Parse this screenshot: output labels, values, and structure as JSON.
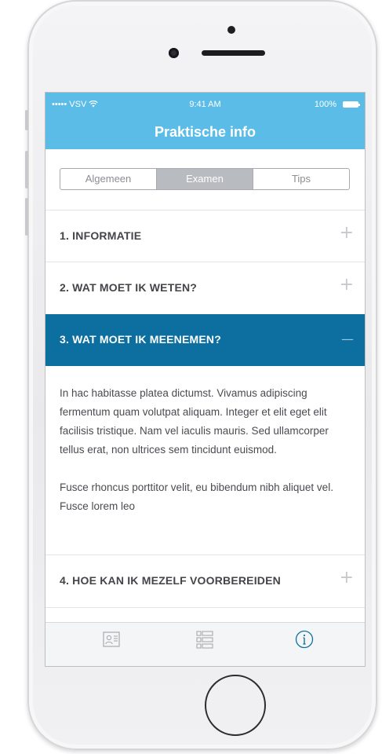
{
  "status_bar": {
    "carrier": "••••• VSV",
    "wifi_icon": "wifi-icon",
    "time": "9:41 AM",
    "battery": "100%"
  },
  "nav": {
    "title": "Praktische info"
  },
  "segments": [
    {
      "label": "Algemeen",
      "active": false
    },
    {
      "label": "Examen",
      "active": true
    },
    {
      "label": "Tips",
      "active": false
    }
  ],
  "accordion": [
    {
      "label": "1. INFORMATIE",
      "icon": "+",
      "expanded": false
    },
    {
      "label": "2. WAT MOET IK WETEN?",
      "icon": "+",
      "expanded": false
    },
    {
      "label": "3. WAT MOET IK MEENEMEN?",
      "icon": "—",
      "expanded": true
    },
    {
      "label": "4. HOE KAN IK MEZELF VOORBEREIDEN",
      "icon": "+",
      "expanded": false
    }
  ],
  "expanded_content": {
    "paragraph1": "In hac habitasse platea dictumst. Vivamus adipiscing fermentum quam volutpat aliquam. Integer et elit eget elit facilisis tristique. Nam vel iaculis mauris. Sed ullamcorper tellus erat, non ultrices sem tincidunt euismod.",
    "paragraph2": "Fusce rhoncus porttitor velit, eu bibendum nibh aliquet vel. Fusce lorem leo"
  },
  "tabbar": {
    "tabs": [
      {
        "icon": "id-card-icon",
        "active": false
      },
      {
        "icon": "list-icon",
        "active": false
      },
      {
        "icon": "info-icon",
        "active": true
      }
    ]
  },
  "colors": {
    "header_blue": "#5bbde7",
    "active_row_blue": "#0c6fa0",
    "segment_active": "#b8bbc0",
    "tab_active": "#0c6fa0"
  }
}
